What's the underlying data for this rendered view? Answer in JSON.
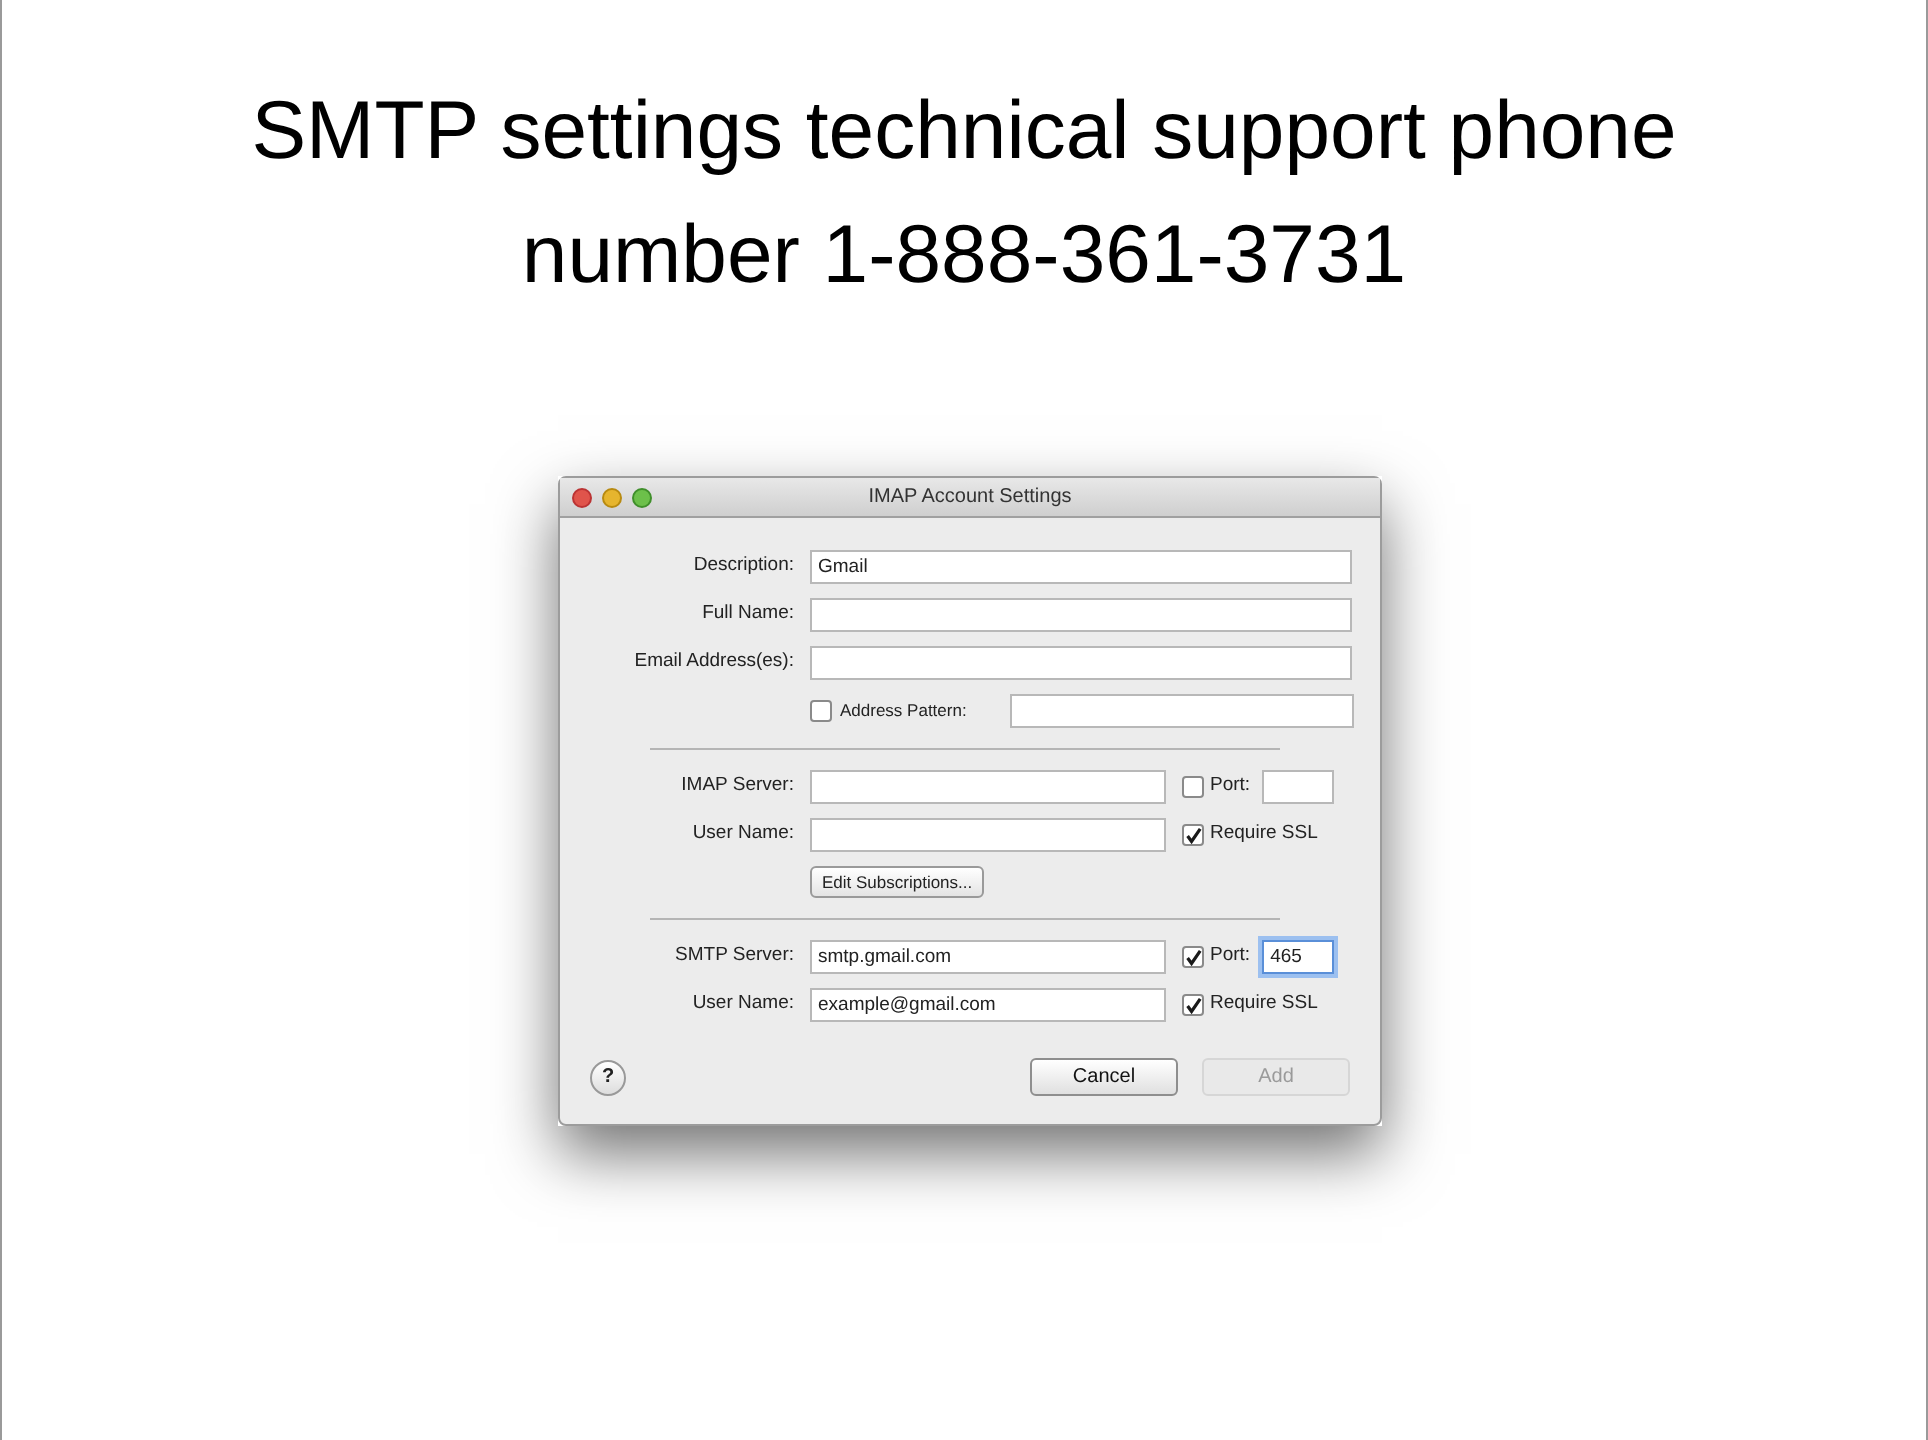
{
  "slide": {
    "title": "SMTP settings technical support phone number 1-888-361-3731"
  },
  "window": {
    "title": "IMAP Account Settings"
  },
  "sections": [
    {
      "rows": [
        {
          "label": "Description:",
          "value": "Gmail"
        },
        {
          "label": "Full Name:"
        },
        {
          "label": "Email Address(es):"
        },
        {
          "option": {
            "label": "Address Pattern:",
            "checked": false
          }
        }
      ]
    },
    {
      "rows": [
        {
          "label": "IMAP Server:",
          "option": {
            "label": "Port:",
            "checked": false,
            "kind": "port"
          }
        },
        {
          "label": "User Name:",
          "option": {
            "label": "Require SSL",
            "checked": true,
            "kind": "plain"
          }
        }
      ],
      "button": "Edit Subscriptions..."
    },
    {
      "rows": [
        {
          "label": "SMTP Server:",
          "value": "smtp.gmail.com",
          "option": {
            "label": "Port:",
            "checked": true,
            "kind": "port",
            "value": "465",
            "focused": true
          }
        },
        {
          "label": "User Name:",
          "value": "example@gmail.com",
          "option": {
            "label": "Require SSL",
            "checked": true,
            "kind": "plain"
          }
        }
      ]
    }
  ],
  "help": "?",
  "buttons": [
    {
      "label": "Cancel",
      "disabled": false
    },
    {
      "label": "Add",
      "disabled": true
    }
  ]
}
